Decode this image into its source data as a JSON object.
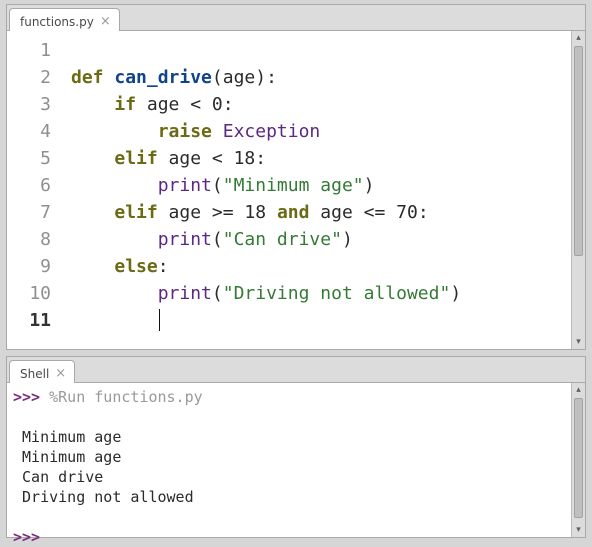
{
  "editor": {
    "tab_label": "functions.py",
    "lines": [
      "1",
      "2",
      "3",
      "4",
      "5",
      "6",
      "7",
      "8",
      "9",
      "10",
      "11"
    ],
    "current_line_index": 10,
    "code": {
      "l2": {
        "def": "def",
        "name": "can_drive",
        "paren_open": "(",
        "arg": "age",
        "paren_close": ")",
        "colon": ":"
      },
      "l3": {
        "if": "if",
        "expr": " age < 0",
        "colon": ":"
      },
      "l4": {
        "raise": "raise",
        "exc": "Exception"
      },
      "l5": {
        "elif": "elif",
        "expr": " age < 18",
        "colon": ":"
      },
      "l6": {
        "print": "print",
        "po": "(",
        "str": "\"Minimum age\"",
        "pc": ")"
      },
      "l7": {
        "elif": "elif",
        "e1": " age >= 18 ",
        "and": "and",
        "e2": " age <= 70",
        "colon": ":"
      },
      "l8": {
        "print": "print",
        "po": "(",
        "str": "\"Can drive\"",
        "pc": ")"
      },
      "l9": {
        "else": "else",
        "colon": ":"
      },
      "l10": {
        "print": "print",
        "po": "(",
        "str": "\"Driving not allowed\"",
        "pc": ")"
      }
    }
  },
  "shell": {
    "tab_label": "Shell",
    "prompt": ">>>",
    "run_cmd": " %Run functions.py",
    "output": [
      "Minimum age",
      "Minimum age",
      "Can drive",
      "Driving not allowed"
    ]
  }
}
